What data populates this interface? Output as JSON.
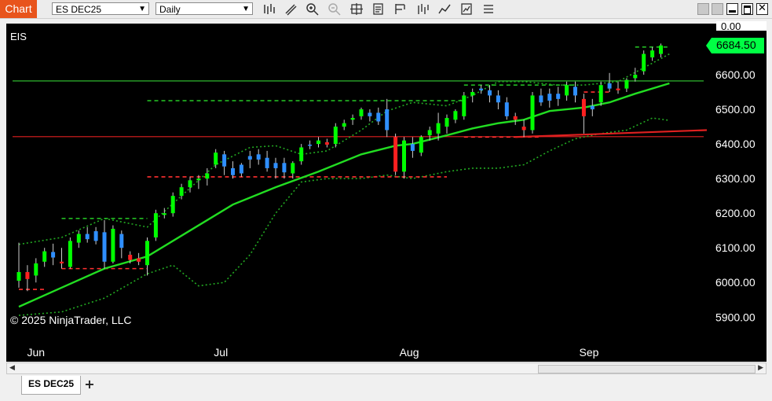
{
  "window": {
    "tab_label": "Chart",
    "instrument": "ES DEC25",
    "interval": "Daily"
  },
  "toolbar": {
    "icons": [
      "bar-type-icon",
      "drawing-tool-icon",
      "zoom-in-icon",
      "zoom-out-icon",
      "crosshair-icon",
      "data-box-icon",
      "strategies-icon",
      "indicators-icon",
      "chart-style-icon",
      "templates-icon",
      "properties-icon"
    ]
  },
  "chart": {
    "symbol_label": "EIS",
    "copyright": "© 2025 NinjaTrader, LLC",
    "last_price": "6684.50",
    "top_label": "0.00",
    "price_axis": [
      {
        "label": "6600.00",
        "value": 6600
      },
      {
        "label": "6500.00",
        "value": 6500
      },
      {
        "label": "6400.00",
        "value": 6400
      },
      {
        "label": "6300.00",
        "value": 6300
      },
      {
        "label": "6200.00",
        "value": 6200
      },
      {
        "label": "6100.00",
        "value": 6100
      },
      {
        "label": "6000.00",
        "value": 6000
      },
      {
        "label": "5900.00",
        "value": 5900
      }
    ],
    "time_axis": [
      {
        "label": "Jun",
        "index": 0.9
      },
      {
        "label": "Jul",
        "index": 22.5
      },
      {
        "label": "Aug",
        "index": 44.5
      },
      {
        "label": "Sep",
        "index": 65.5
      }
    ],
    "horizontal_lines": [
      {
        "price": 6582,
        "color": "#33cc33"
      },
      {
        "price": 6421,
        "color": "#e02020"
      }
    ],
    "colors": {
      "up": "#00ff00",
      "down": "#ff2020",
      "neutral": "#2f8fff",
      "sma": "#22dd22",
      "bands": "#22aa22",
      "levels_green": "#22bb22",
      "levels_red": "#ff3030",
      "trend": "#e02020"
    }
  },
  "chart_data": {
    "type": "candlestick",
    "ylim": [
      5850,
      6710
    ],
    "candles": [
      {
        "o": 6005,
        "h": 6115,
        "l": 5985,
        "c": 6030,
        "col": "up"
      },
      {
        "o": 6030,
        "h": 6050,
        "l": 5975,
        "c": 6010,
        "col": "down"
      },
      {
        "o": 6020,
        "h": 6070,
        "l": 6000,
        "c": 6055,
        "col": "up"
      },
      {
        "o": 6060,
        "h": 6100,
        "l": 6045,
        "c": 6090,
        "col": "up"
      },
      {
        "o": 6088,
        "h": 6112,
        "l": 6050,
        "c": 6072,
        "col": "neutral"
      },
      {
        "o": 6060,
        "h": 6100,
        "l": 6040,
        "c": 6055,
        "col": "down"
      },
      {
        "o": 6045,
        "h": 6130,
        "l": 6040,
        "c": 6120,
        "col": "up"
      },
      {
        "o": 6115,
        "h": 6150,
        "l": 6100,
        "c": 6140,
        "col": "up"
      },
      {
        "o": 6140,
        "h": 6160,
        "l": 6115,
        "c": 6125,
        "col": "neutral"
      },
      {
        "o": 6120,
        "h": 6160,
        "l": 6110,
        "c": 6148,
        "col": "neutral"
      },
      {
        "o": 6145,
        "h": 6180,
        "l": 6040,
        "c": 6060,
        "col": "neutral"
      },
      {
        "o": 6060,
        "h": 6165,
        "l": 6055,
        "c": 6155,
        "col": "up"
      },
      {
        "o": 6140,
        "h": 6150,
        "l": 6070,
        "c": 6100,
        "col": "neutral"
      },
      {
        "o": 6080,
        "h": 6090,
        "l": 6055,
        "c": 6065,
        "col": "down"
      },
      {
        "o": 6070,
        "h": 6085,
        "l": 6050,
        "c": 6060,
        "col": "down"
      },
      {
        "o": 6050,
        "h": 6130,
        "l": 6020,
        "c": 6120,
        "col": "up"
      },
      {
        "o": 6130,
        "h": 6210,
        "l": 6120,
        "c": 6200,
        "col": "up"
      },
      {
        "o": 6200,
        "h": 6215,
        "l": 6185,
        "c": 6195,
        "col": "up"
      },
      {
        "o": 6200,
        "h": 6260,
        "l": 6190,
        "c": 6250,
        "col": "up"
      },
      {
        "o": 6250,
        "h": 6285,
        "l": 6240,
        "c": 6275,
        "col": "up"
      },
      {
        "o": 6275,
        "h": 6305,
        "l": 6260,
        "c": 6295,
        "col": "up"
      },
      {
        "o": 6295,
        "h": 6310,
        "l": 6270,
        "c": 6300,
        "col": "up"
      },
      {
        "o": 6300,
        "h": 6330,
        "l": 6280,
        "c": 6315,
        "col": "up"
      },
      {
        "o": 6340,
        "h": 6385,
        "l": 6330,
        "c": 6375,
        "col": "up"
      },
      {
        "o": 6370,
        "h": 6380,
        "l": 6310,
        "c": 6335,
        "col": "neutral"
      },
      {
        "o": 6330,
        "h": 6350,
        "l": 6300,
        "c": 6310,
        "col": "neutral"
      },
      {
        "o": 6315,
        "h": 6345,
        "l": 6305,
        "c": 6340,
        "col": "neutral"
      },
      {
        "o": 6355,
        "h": 6380,
        "l": 6330,
        "c": 6365,
        "col": "neutral"
      },
      {
        "o": 6370,
        "h": 6385,
        "l": 6340,
        "c": 6355,
        "col": "neutral"
      },
      {
        "o": 6360,
        "h": 6380,
        "l": 6320,
        "c": 6330,
        "col": "neutral"
      },
      {
        "o": 6330,
        "h": 6360,
        "l": 6300,
        "c": 6345,
        "col": "neutral"
      },
      {
        "o": 6345,
        "h": 6360,
        "l": 6300,
        "c": 6318,
        "col": "neutral"
      },
      {
        "o": 6315,
        "h": 6350,
        "l": 6300,
        "c": 6345,
        "col": "up"
      },
      {
        "o": 6350,
        "h": 6400,
        "l": 6340,
        "c": 6390,
        "col": "up"
      },
      {
        "o": 6395,
        "h": 6410,
        "l": 6385,
        "c": 6398,
        "col": "neutral"
      },
      {
        "o": 6400,
        "h": 6420,
        "l": 6390,
        "c": 6410,
        "col": "up"
      },
      {
        "o": 6405,
        "h": 6415,
        "l": 6390,
        "c": 6398,
        "col": "down"
      },
      {
        "o": 6400,
        "h": 6460,
        "l": 6390,
        "c": 6450,
        "col": "up"
      },
      {
        "o": 6450,
        "h": 6470,
        "l": 6440,
        "c": 6460,
        "col": "up"
      },
      {
        "o": 6470,
        "h": 6485,
        "l": 6455,
        "c": 6475,
        "col": "up"
      },
      {
        "o": 6480,
        "h": 6505,
        "l": 6470,
        "c": 6500,
        "col": "up"
      },
      {
        "o": 6490,
        "h": 6500,
        "l": 6465,
        "c": 6480,
        "col": "neutral"
      },
      {
        "o": 6490,
        "h": 6505,
        "l": 6455,
        "c": 6465,
        "col": "neutral"
      },
      {
        "o": 6500,
        "h": 6530,
        "l": 6420,
        "c": 6440,
        "col": "neutral"
      },
      {
        "o": 6420,
        "h": 6430,
        "l": 6310,
        "c": 6320,
        "col": "down"
      },
      {
        "o": 6320,
        "h": 6420,
        "l": 6300,
        "c": 6410,
        "col": "up"
      },
      {
        "o": 6400,
        "h": 6420,
        "l": 6360,
        "c": 6380,
        "col": "neutral"
      },
      {
        "o": 6375,
        "h": 6425,
        "l": 6365,
        "c": 6420,
        "col": "up"
      },
      {
        "o": 6425,
        "h": 6450,
        "l": 6410,
        "c": 6440,
        "col": "up"
      },
      {
        "o": 6430,
        "h": 6490,
        "l": 6410,
        "c": 6460,
        "col": "up"
      },
      {
        "o": 6450,
        "h": 6485,
        "l": 6430,
        "c": 6475,
        "col": "up"
      },
      {
        "o": 6470,
        "h": 6500,
        "l": 6460,
        "c": 6495,
        "col": "up"
      },
      {
        "o": 6480,
        "h": 6550,
        "l": 6470,
        "c": 6540,
        "col": "up"
      },
      {
        "o": 6540,
        "h": 6560,
        "l": 6520,
        "c": 6550,
        "col": "up"
      },
      {
        "o": 6555,
        "h": 6570,
        "l": 6545,
        "c": 6560,
        "col": "neutral"
      },
      {
        "o": 6555,
        "h": 6570,
        "l": 6520,
        "c": 6540,
        "col": "neutral"
      },
      {
        "o": 6540,
        "h": 6555,
        "l": 6500,
        "c": 6520,
        "col": "neutral"
      },
      {
        "o": 6520,
        "h": 6535,
        "l": 6470,
        "c": 6480,
        "col": "neutral"
      },
      {
        "o": 6480,
        "h": 6490,
        "l": 6455,
        "c": 6470,
        "col": "down"
      },
      {
        "o": 6450,
        "h": 6470,
        "l": 6420,
        "c": 6440,
        "col": "down"
      },
      {
        "o": 6440,
        "h": 6550,
        "l": 6430,
        "c": 6540,
        "col": "up"
      },
      {
        "o": 6540,
        "h": 6560,
        "l": 6510,
        "c": 6520,
        "col": "neutral"
      },
      {
        "o": 6525,
        "h": 6560,
        "l": 6505,
        "c": 6545,
        "col": "neutral"
      },
      {
        "o": 6545,
        "h": 6565,
        "l": 6510,
        "c": 6530,
        "col": "neutral"
      },
      {
        "o": 6540,
        "h": 6580,
        "l": 6525,
        "c": 6570,
        "col": "up"
      },
      {
        "o": 6565,
        "h": 6580,
        "l": 6520,
        "c": 6540,
        "col": "neutral"
      },
      {
        "o": 6530,
        "h": 6545,
        "l": 6430,
        "c": 6480,
        "col": "down"
      },
      {
        "o": 6500,
        "h": 6530,
        "l": 6480,
        "c": 6510,
        "col": "neutral"
      },
      {
        "o": 6520,
        "h": 6580,
        "l": 6510,
        "c": 6570,
        "col": "up"
      },
      {
        "o": 6575,
        "h": 6605,
        "l": 6550,
        "c": 6560,
        "col": "neutral"
      },
      {
        "o": 6560,
        "h": 6580,
        "l": 6545,
        "c": 6555,
        "col": "down"
      },
      {
        "o": 6560,
        "h": 6590,
        "l": 6550,
        "c": 6585,
        "col": "up"
      },
      {
        "o": 6590,
        "h": 6620,
        "l": 6580,
        "c": 6600,
        "col": "up"
      },
      {
        "o": 6610,
        "h": 6670,
        "l": 6600,
        "c": 6660,
        "col": "up"
      },
      {
        "o": 6650,
        "h": 6680,
        "l": 6640,
        "c": 6670,
        "col": "up"
      },
      {
        "o": 6660,
        "h": 6690,
        "l": 6650,
        "c": 6684.5,
        "col": "up"
      }
    ],
    "sma": [
      [
        0,
        5930
      ],
      [
        5,
        5985
      ],
      [
        10,
        6040
      ],
      [
        15,
        6075
      ],
      [
        20,
        6150
      ],
      [
        25,
        6225
      ],
      [
        30,
        6275
      ],
      [
        35,
        6320
      ],
      [
        40,
        6370
      ],
      [
        44,
        6395
      ],
      [
        46,
        6400
      ],
      [
        50,
        6425
      ],
      [
        53,
        6445
      ],
      [
        56,
        6460
      ],
      [
        59,
        6470
      ],
      [
        62,
        6495
      ],
      [
        66,
        6505
      ],
      [
        69,
        6520
      ],
      [
        72,
        6545
      ],
      [
        76,
        6575
      ]
    ],
    "band_upper": [
      [
        0,
        6110
      ],
      [
        5,
        6130
      ],
      [
        10,
        6185
      ],
      [
        15,
        6160
      ],
      [
        19,
        6250
      ],
      [
        23,
        6340
      ],
      [
        27,
        6390
      ],
      [
        30,
        6395
      ],
      [
        33,
        6370
      ],
      [
        36,
        6380
      ],
      [
        40,
        6440
      ],
      [
        43,
        6495
      ],
      [
        46,
        6520
      ],
      [
        50,
        6510
      ],
      [
        53,
        6540
      ],
      [
        56,
        6580
      ],
      [
        59,
        6580
      ],
      [
        63,
        6570
      ],
      [
        66,
        6570
      ],
      [
        70,
        6580
      ],
      [
        73,
        6620
      ],
      [
        76,
        6660
      ]
    ],
    "band_lower": [
      [
        0,
        5905
      ],
      [
        5,
        5915
      ],
      [
        10,
        5955
      ],
      [
        15,
        6025
      ],
      [
        18,
        6050
      ],
      [
        21,
        5990
      ],
      [
        24,
        6000
      ],
      [
        27,
        6080
      ],
      [
        30,
        6200
      ],
      [
        33,
        6290
      ],
      [
        36,
        6300
      ],
      [
        40,
        6300
      ],
      [
        43,
        6310
      ],
      [
        46,
        6300
      ],
      [
        50,
        6320
      ],
      [
        53,
        6330
      ],
      [
        56,
        6330
      ],
      [
        59,
        6340
      ],
      [
        62,
        6380
      ],
      [
        65,
        6415
      ],
      [
        68,
        6430
      ],
      [
        71,
        6440
      ],
      [
        74,
        6475
      ],
      [
        76,
        6468
      ]
    ],
    "levels_green": [
      {
        "price": 6185,
        "from": 5,
        "to": 15
      },
      {
        "price": 6525,
        "from": 15,
        "to": 52
      },
      {
        "price": 6570,
        "from": 52,
        "to": 65
      },
      {
        "price": 6680,
        "from": 72,
        "to": 76
      }
    ],
    "levels_red": [
      {
        "price": 5980,
        "from": 0,
        "to": 3
      },
      {
        "price": 6040,
        "from": 5,
        "to": 15
      },
      {
        "price": 6305,
        "from": 15,
        "to": 50
      },
      {
        "price": 6420,
        "from": 52,
        "to": 61
      },
      {
        "price": 6550,
        "from": 66,
        "to": 69
      }
    ],
    "trendline": [
      [
        58,
        6420
      ],
      [
        77,
        6440
      ]
    ]
  }
}
